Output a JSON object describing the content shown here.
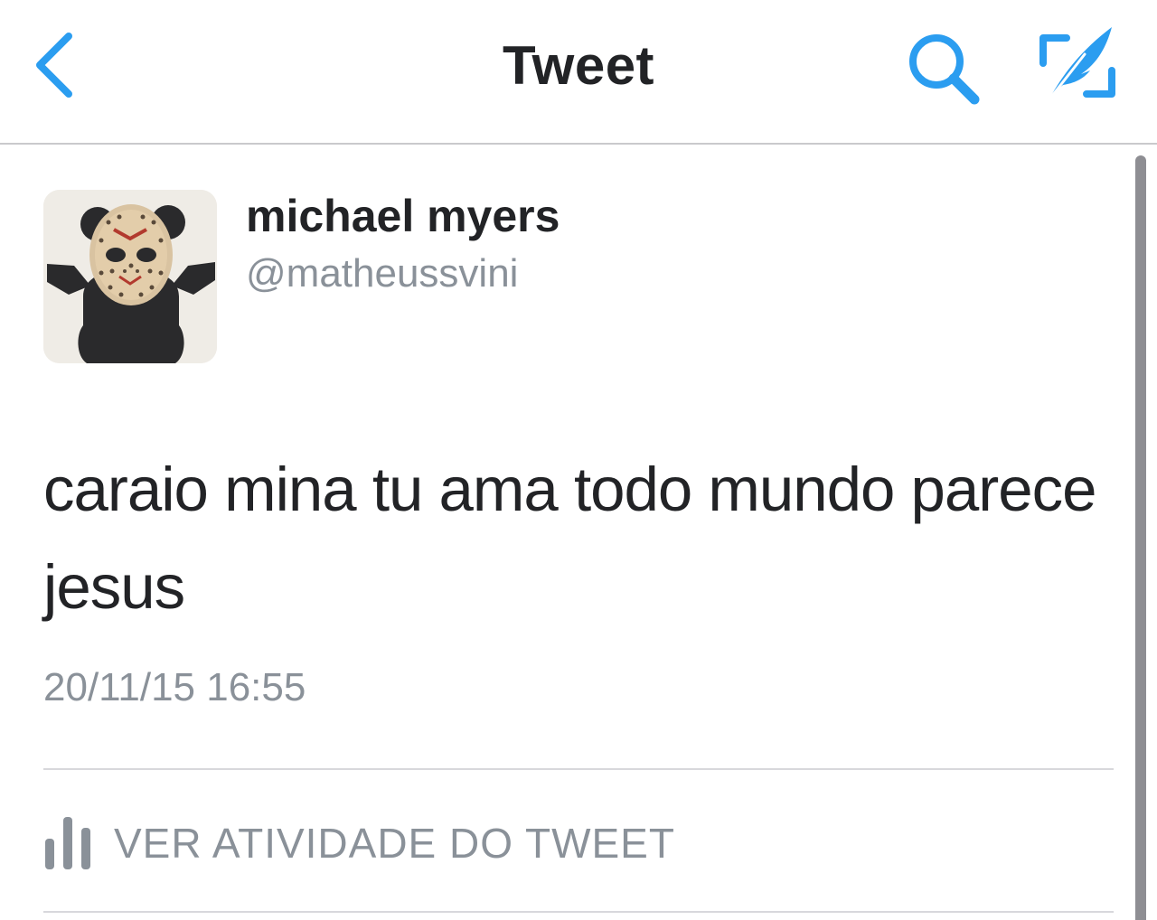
{
  "navbar": {
    "title": "Tweet",
    "back_icon": "chevron-left-icon",
    "search_icon": "search-icon",
    "compose_icon": "compose-tweet-icon",
    "accent_color": "#2b9df0"
  },
  "tweet": {
    "user_name": "michael myers",
    "user_handle": "@matheussvini",
    "text": "caraio mina tu ama todo mundo parece jesus",
    "timestamp": "20/11/15 16:55"
  },
  "activity": {
    "icon": "bar-chart-icon",
    "label": "VER ATIVIDADE DO TWEET"
  }
}
